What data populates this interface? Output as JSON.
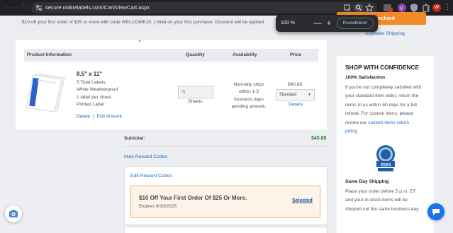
{
  "browser": {
    "url": "secure.onlinelabels.com/Cart/ViewCart.aspx",
    "profile_initial": "W",
    "zoom": {
      "level": "100 %",
      "minus": "—",
      "plus": "+",
      "reset_label": "Restablecer"
    }
  },
  "promo": {
    "text": "$10 off your first order of $25 or more with code WELCOME10. | Valid on your first purchase. Discount will be applied"
  },
  "checkout": {
    "label": "eckout",
    "estimate_shipping": "Estimate Shipping"
  },
  "cart": {
    "headers": {
      "product": "Product Information",
      "quantity": "Quantity",
      "availability": "Availability",
      "price": "Price"
    },
    "item": {
      "name": "8.5\" x 11\"",
      "desc": [
        "5 Total Labels",
        "White Weatherproof",
        "1 label per sheet",
        "Printed Label"
      ],
      "delete": "Delete",
      "sep": "|",
      "edit_artwork": "Edit Artwork",
      "quantity": "5",
      "unit": "Sheets",
      "availability": [
        "Normally ships",
        "within 1-3",
        "business days",
        "pending artwork."
      ],
      "price": "$40.88",
      "shipping_option": "Standard",
      "details": "Details"
    },
    "subtotal_label": "Subtotal:",
    "subtotal_value": "$40.88",
    "hide_reward_codes": "Hide Reward Codes",
    "edit_reward_codes": "Edit Reward Codes",
    "offer": {
      "title": "$10 Off Your First Order Of $25 Or More.",
      "expires": "Expires 9/30/2025",
      "status": "Selected"
    }
  },
  "sidebar": {
    "heading": "SHOP WITH CONFIDENCE",
    "satisfaction_title": "100% Satisfaction",
    "satisfaction_lines": [
      "If you're not completely satisfied with",
      "your standard item order, return the",
      "items to us within 60 days for a full",
      "refund. For custom items, please"
    ],
    "satisfaction_line5_pre": "review our ",
    "satisfaction_link1": "custom items return",
    "satisfaction_link2": "policy",
    "satisfaction_end": ".",
    "badge_year": "2024",
    "same_day_title": "Same Day Shipping",
    "same_day_lines": [
      "Place your order before 5 p.m. ET",
      "and your in-stock items will be",
      "shipped out the same business day."
    ]
  },
  "colors": {
    "accent": "#f18b29",
    "link": "#1b6ec2",
    "subtotal": "#2e8b2e",
    "chat": "#1a73e8"
  }
}
